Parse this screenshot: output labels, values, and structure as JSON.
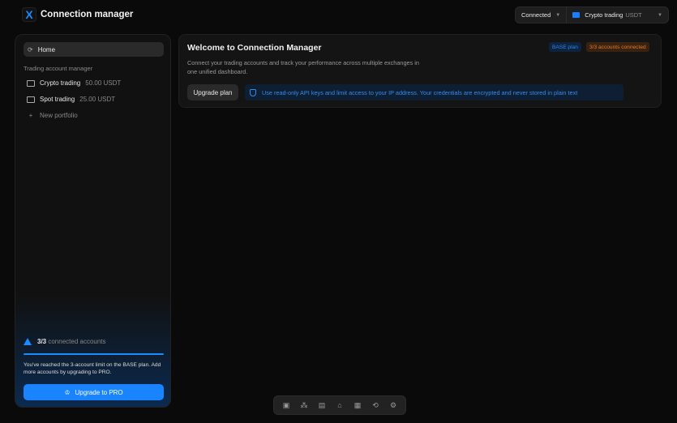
{
  "header": {
    "logo": "X",
    "title": "Connection manager",
    "status": "Connected",
    "portfolio": "Crypto trading",
    "portfolio_currency": "USDT"
  },
  "sidebar": {
    "home": "Home",
    "section": "Trading account manager",
    "portfolios": [
      {
        "name": "Crypto trading",
        "balance": "50.00 USDT"
      },
      {
        "name": "Spot trading",
        "balance": "25.00 USDT"
      }
    ],
    "new_portfolio": "New portfolio",
    "limit": {
      "count": "3/3",
      "label": "connected accounts",
      "progress": 1.0,
      "message": "You've reached the 3-account limit on the BASE plan. Add more accounts by upgrading to PRO.",
      "button": "Upgrade to PRO"
    }
  },
  "main": {
    "title": "Welcome to Connection Manager",
    "description": "Connect your trading accounts and track your performance across multiple exchanges in one unified dashboard.",
    "plan_badge": "BASE plan",
    "accounts_badge": "3/3 accounts connected",
    "upgrade_button": "Upgrade plan",
    "info": "Use read-only API keys and limit access to your IP address. Your credentials are encrypted and never stored in plain text"
  },
  "dock": {
    "icons": [
      "box-icon",
      "nodes-icon",
      "notes-icon",
      "home-icon",
      "calendar-icon",
      "sync-icon",
      "settings-icon"
    ]
  },
  "colors": {
    "accent": "#1a84ff",
    "warning": "#e07a2c"
  }
}
